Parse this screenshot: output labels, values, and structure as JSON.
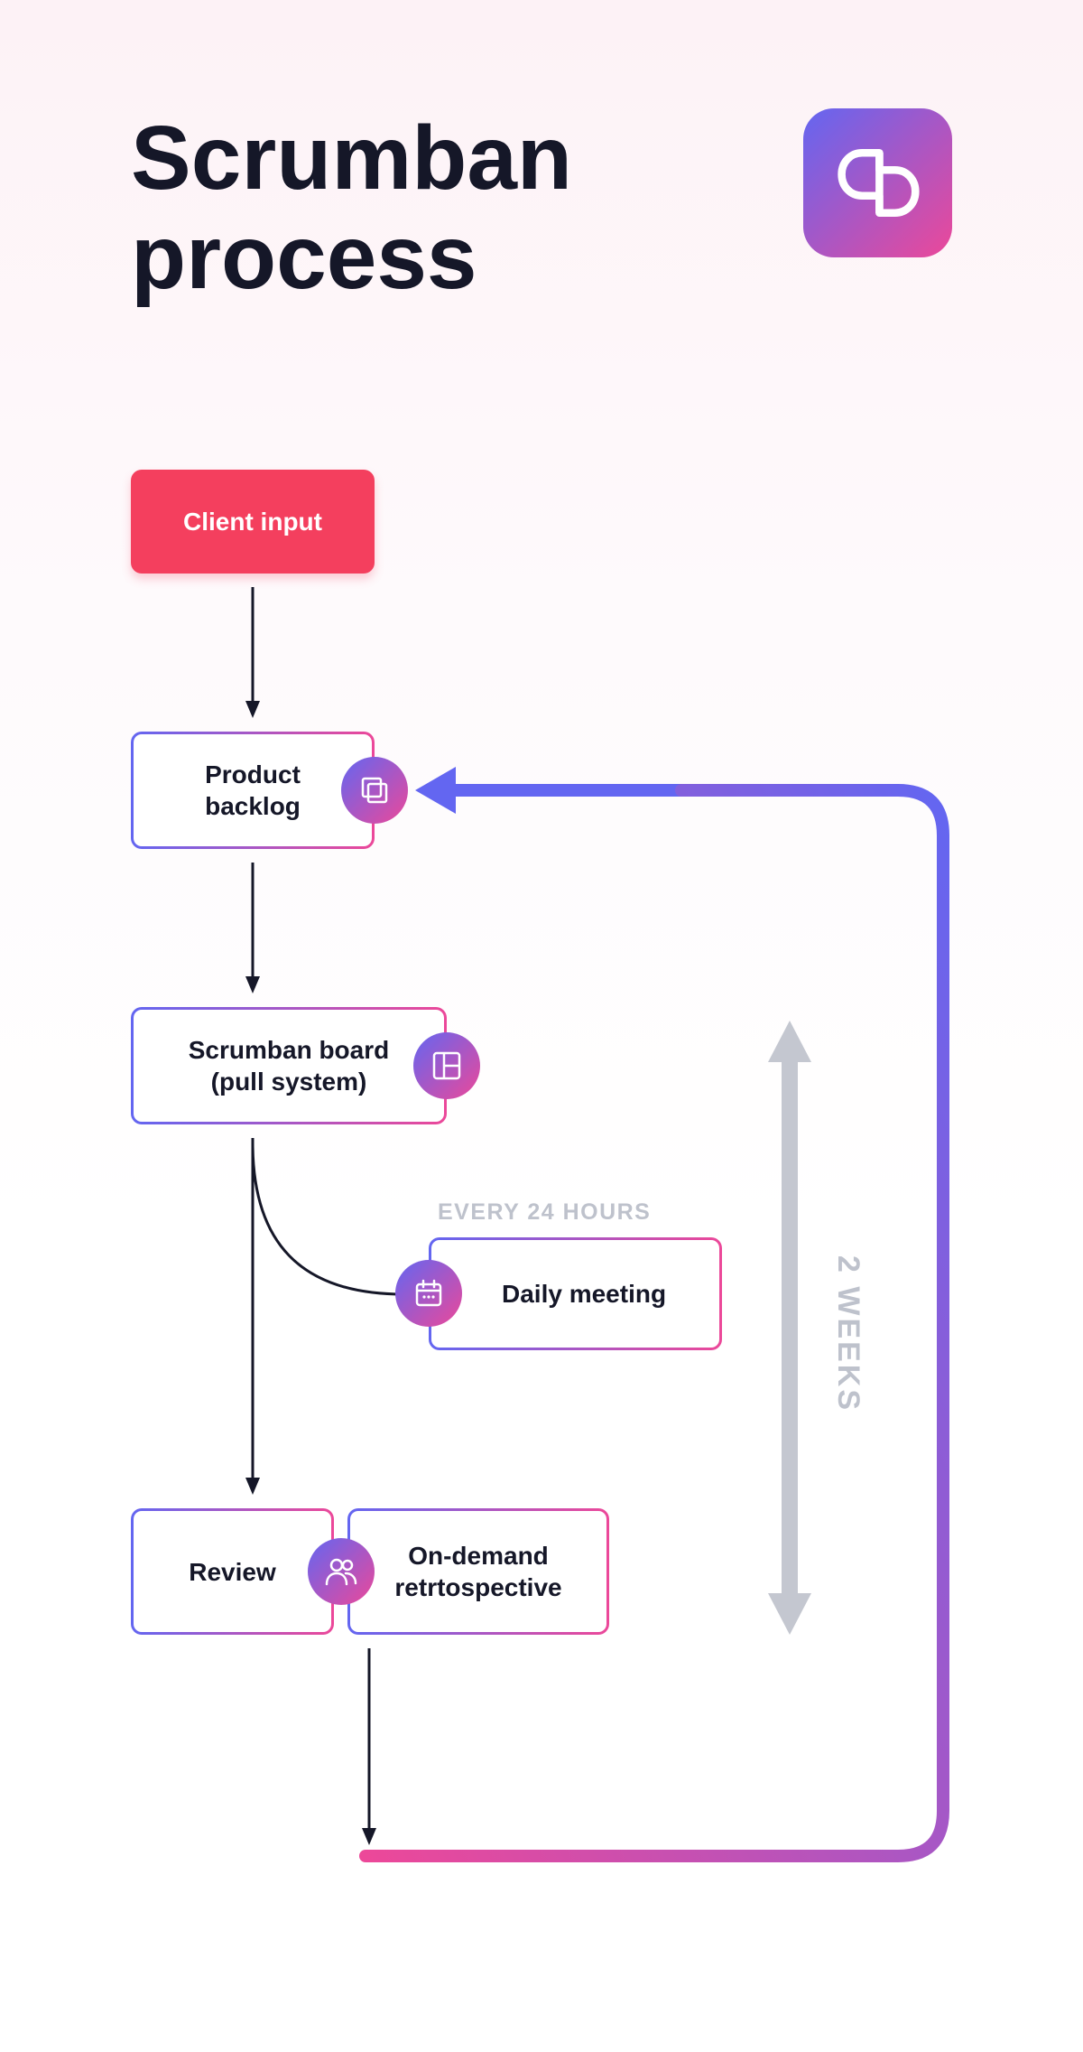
{
  "title": "Scrumban\nprocess",
  "logo_name": "logo-icon",
  "nodes": {
    "client_input": "Client input",
    "product_backlog": "Product\nbacklog",
    "scrumban_board": "Scrumban board\n(pull system)",
    "daily_meeting": "Daily meeting",
    "review": "Review",
    "retrospective": "On-demand\nretrtospective"
  },
  "labels": {
    "every24": "EVERY 24  HOURS",
    "two_weeks": "2 WEEKS"
  },
  "icons": {
    "backlog": "stack-icon",
    "board": "board-icon",
    "daily": "calendar-icon",
    "people": "people-icon"
  }
}
